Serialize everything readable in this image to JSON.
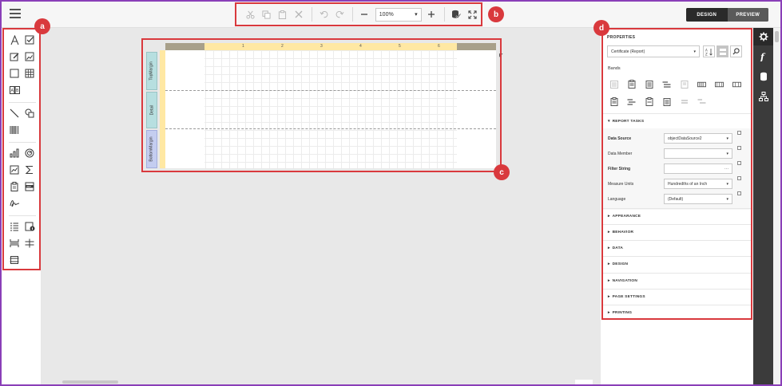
{
  "toolbar": {
    "zoom_value": "100%",
    "icons": [
      "cut-icon",
      "copy-icon",
      "paste-icon",
      "delete-icon",
      "undo-icon",
      "redo-icon",
      "zoom-out-icon",
      "zoom-in-icon",
      "validate-icon",
      "fullscreen-icon"
    ]
  },
  "mode": {
    "design_label": "DESIGN",
    "preview_label": "PREVIEW",
    "active": "DESIGN"
  },
  "callouts": {
    "a": "a",
    "b": "b",
    "c": "c",
    "d": "d"
  },
  "report": {
    "ruler_numbers": [
      "1",
      "2",
      "3",
      "4",
      "5",
      "6"
    ],
    "bands": [
      "TopMargin",
      "Detail",
      "BottomMargin"
    ]
  },
  "properties": {
    "title": "PROPERTIES",
    "selected_object": "Certificate (Report)",
    "bands_label": "Bands",
    "report_tasks_title": "REPORT TASKS",
    "fields": [
      {
        "label": "Data Source",
        "value": "objectDataSource2",
        "type": "select",
        "bold": true
      },
      {
        "label": "Data Member",
        "value": "",
        "type": "select",
        "bold": false
      },
      {
        "label": "Filter String",
        "value": "",
        "type": "ellipsis",
        "bold": true
      },
      {
        "label": "Measure Units",
        "value": "Hundredths of an Inch",
        "type": "select",
        "bold": false
      },
      {
        "label": "Language",
        "value": "(Default)",
        "type": "select",
        "bold": false
      }
    ],
    "sections": [
      "APPEARANCE",
      "BEHAVIOR",
      "DATA",
      "DESIGN",
      "NAVIGATION",
      "PAGE SETTINGS",
      "PRINTING"
    ],
    "section_prefix_icon": "caret-right-icon",
    "tasks_prefix_icon": "caret-down-icon"
  },
  "glyphs": {
    "caret_down": "▾",
    "caret_right": "▸",
    "ellipsis": "···",
    "report_tasks_caret": "▾",
    "small_handle": "◤"
  },
  "colors": {
    "callout": "#d9393d",
    "rail": "#3b3b3b",
    "ruler": "#ffe8a3",
    "band_label": "#b7dfe0"
  }
}
